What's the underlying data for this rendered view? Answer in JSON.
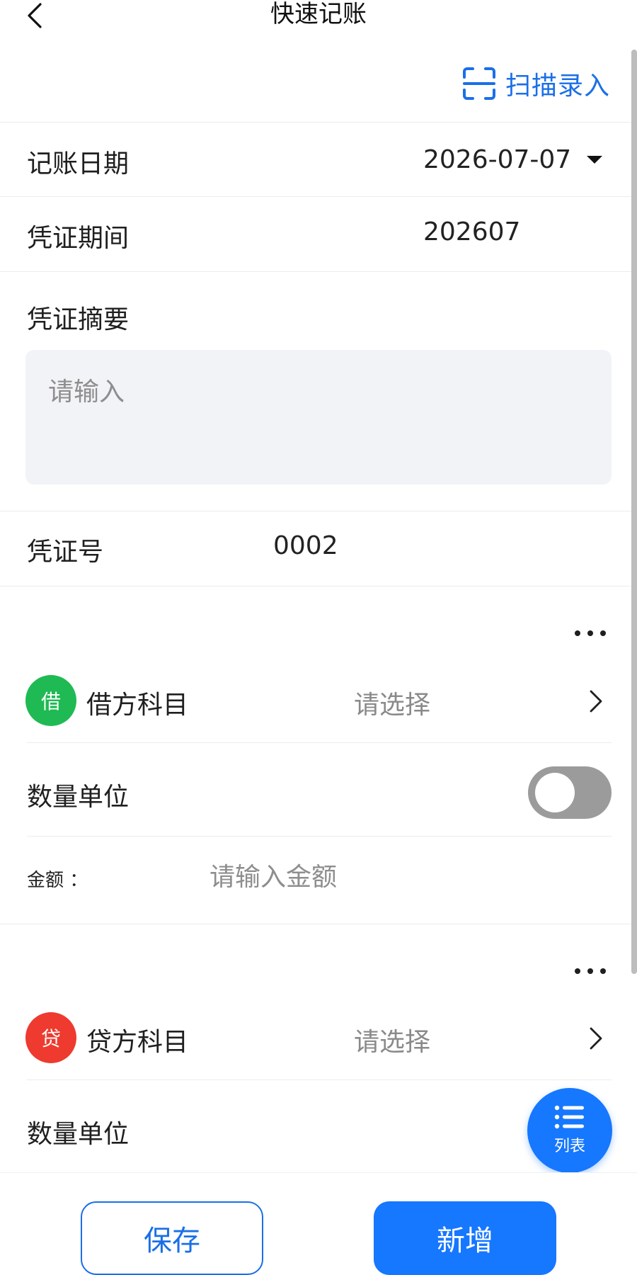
{
  "header": {
    "title": "快速记账"
  },
  "scan": {
    "label": "扫描录入"
  },
  "form": {
    "date_label": "记账日期",
    "date_value": "2026-07-07",
    "period_label": "凭证期间",
    "period_value": "202607",
    "summary_label": "凭证摘要",
    "summary_placeholder": "请输入",
    "voucher_no_label": "凭证号",
    "voucher_no_value": "0002"
  },
  "debit": {
    "badge": "借",
    "title": "借方科目",
    "select_placeholder": "请选择",
    "quantity_label": "数量单位",
    "quantity_enabled": false,
    "amount_label": "金额 ：",
    "amount_placeholder": "请输入金额"
  },
  "credit": {
    "badge": "贷",
    "title": "贷方科目",
    "select_placeholder": "请选择",
    "quantity_label": "数量单位"
  },
  "fab": {
    "label": "列表"
  },
  "actions": {
    "save_label": "保存",
    "add_label": "新增"
  },
  "colors": {
    "accent": "#1677ff",
    "debit": "#1fba53",
    "credit": "#ee3a2f"
  }
}
